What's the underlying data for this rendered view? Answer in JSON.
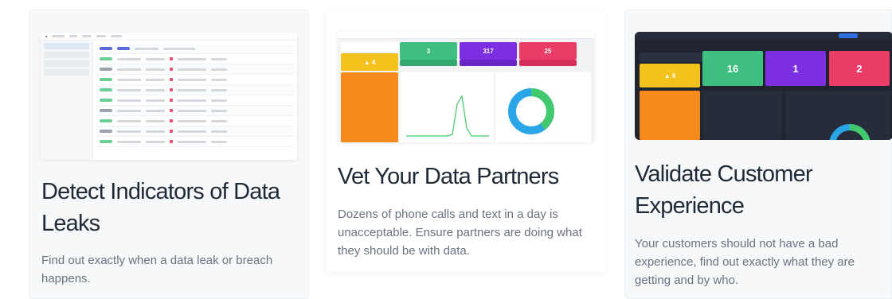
{
  "cards": [
    {
      "title": "Detect Indicators of Data Leaks",
      "description": "Find out exactly when a data leak or breach happens."
    },
    {
      "title": "Vet Your Data Partners",
      "description": "Dozens of phone calls and text in a day is unacceptable. Ensure partners are doing what they should be with data."
    },
    {
      "title": "Validate Customer Experience",
      "description": "Your customers should not have a bad experience, find out exactly what they are getting and by who."
    }
  ],
  "colors": {
    "yellow": "#f4c21c",
    "green": "#3fbf7f",
    "purple": "#7b2fe0",
    "red": "#ea3c67",
    "orange": "#f78a1d",
    "donut_blue": "#2aa6e8",
    "donut_green": "#42c96d"
  }
}
